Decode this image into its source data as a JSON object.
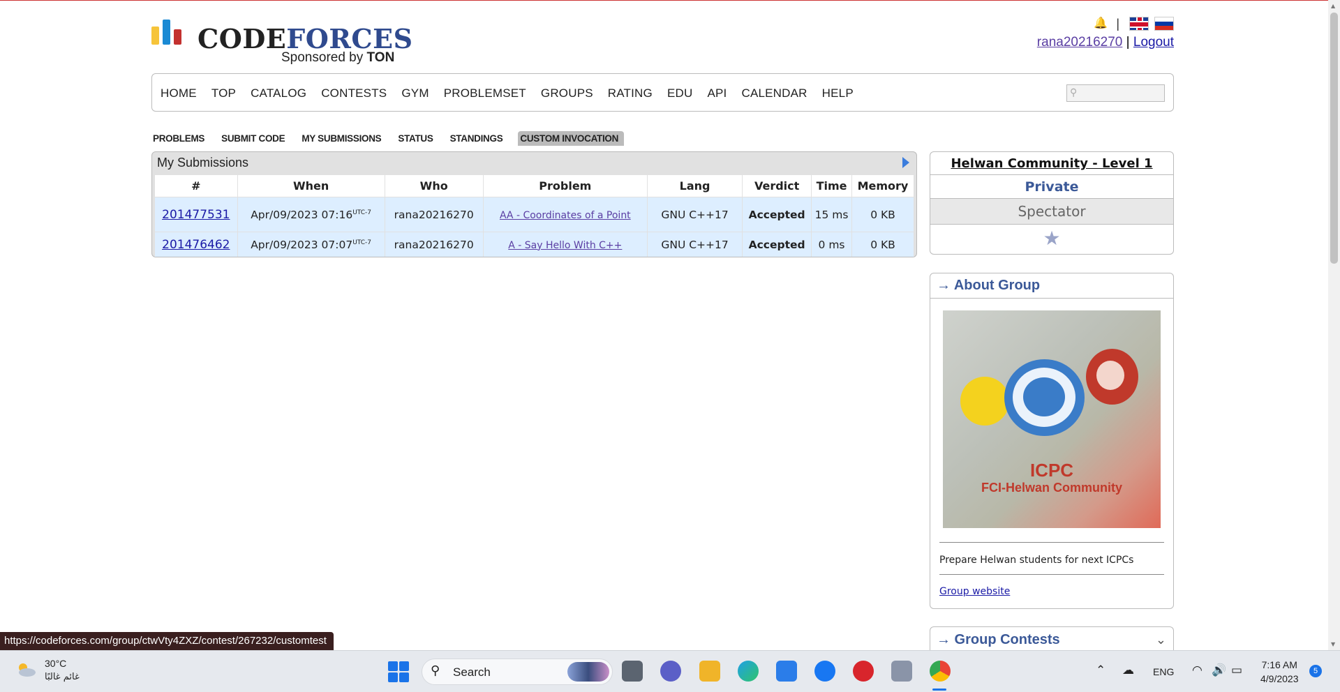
{
  "header": {
    "logo_text_a": "CODE",
    "logo_text_b": "FORCES",
    "logo_sponsor": "Sponsored by",
    "logo_sponsor_name": "TON",
    "separator": "|",
    "username": "rana20216270",
    "logout": "Logout"
  },
  "menu": {
    "items": [
      "HOME",
      "TOP",
      "CATALOG",
      "CONTESTS",
      "GYM",
      "PROBLEMSET",
      "GROUPS",
      "RATING",
      "EDU",
      "API",
      "CALENDAR",
      "HELP"
    ]
  },
  "submenu": {
    "items": [
      "PROBLEMS",
      "SUBMIT CODE",
      "MY SUBMISSIONS",
      "STATUS",
      "STANDINGS",
      "CUSTOM INVOCATION"
    ],
    "active": "CUSTOM INVOCATION"
  },
  "submissions": {
    "title": "My Submissions",
    "columns": [
      "#",
      "When",
      "Who",
      "Problem",
      "Lang",
      "Verdict",
      "Time",
      "Memory"
    ],
    "rows": [
      {
        "id": "201477531",
        "when": "Apr/09/2023 07:16",
        "tz": "UTC-7",
        "who": "rana20216270",
        "problem": "AA - Coordinates of a Point",
        "lang": "GNU C++17",
        "verdict": "Accepted",
        "time": "15 ms",
        "memory": "0 KB"
      },
      {
        "id": "201476462",
        "when": "Apr/09/2023 07:07",
        "tz": "UTC-7",
        "who": "rana20216270",
        "problem": "A - Say Hello With C++",
        "lang": "GNU C++17",
        "verdict": "Accepted",
        "time": "0 ms",
        "memory": "0 KB"
      }
    ]
  },
  "sidebar": {
    "group_name": "Helwan Community - Level 1",
    "privacy": "Private",
    "role": "Spectator",
    "about_title": "→ About Group",
    "about_image_text_1": "ICPC",
    "about_image_text_2": "FCI-Helwan Community",
    "description": "Prepare Helwan students for next ICPCs",
    "website_link": "Group website",
    "contests_title": "→ Group Contests"
  },
  "status_bar": {
    "url": "https://codeforces.com/group/ctwVty4ZXZ/contest/267232/customtest"
  },
  "taskbar": {
    "temperature": "30°C",
    "weather": "غائم غالبًا",
    "search": "Search",
    "language": "ENG",
    "time": "7:16 AM",
    "date": "4/9/2023",
    "notifications": "5"
  },
  "colors": {
    "accent_link": "#1a1aa6",
    "sidebar_title": "#3b5998",
    "verdict_ok": "#00aa00",
    "row_bg": "#ddeeff"
  }
}
